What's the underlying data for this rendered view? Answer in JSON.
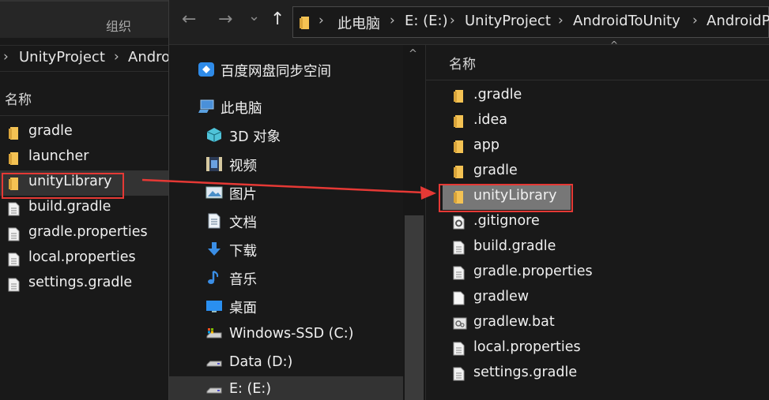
{
  "left_window": {
    "group_label": "组织",
    "breadcrumbs": [
      "UnityProject",
      "Andro"
    ],
    "column_header": "名称",
    "files": [
      {
        "name": "gradle",
        "type": "folder"
      },
      {
        "name": "launcher",
        "type": "folder"
      },
      {
        "name": "unityLibrary",
        "type": "folder",
        "selected": true
      },
      {
        "name": "build.gradle",
        "type": "file"
      },
      {
        "name": "gradle.properties",
        "type": "file"
      },
      {
        "name": "local.properties",
        "type": "file"
      },
      {
        "name": "settings.gradle",
        "type": "file"
      }
    ]
  },
  "right_window": {
    "nav_buttons": {
      "back": "←",
      "forward": "→",
      "recent": "⌄",
      "up": "↑"
    },
    "breadcrumbs": [
      "此电脑",
      "E: (E:)",
      "UnityProject",
      "AndroidToUnity",
      "AndroidP"
    ],
    "nav_tree": [
      {
        "label": "百度网盘同步空间",
        "icon": "baidu-netdisk-icon"
      },
      {
        "label": "此电脑",
        "icon": "this-pc-icon"
      },
      {
        "label": "3D 对象",
        "icon": "3d-objects-icon"
      },
      {
        "label": "视频",
        "icon": "videos-icon"
      },
      {
        "label": "图片",
        "icon": "pictures-icon"
      },
      {
        "label": "文档",
        "icon": "documents-icon"
      },
      {
        "label": "下载",
        "icon": "downloads-icon"
      },
      {
        "label": "音乐",
        "icon": "music-icon"
      },
      {
        "label": "桌面",
        "icon": "desktop-icon"
      },
      {
        "label": "Windows-SSD (C:)",
        "icon": "drive-icon"
      },
      {
        "label": "Data (D:)",
        "icon": "drive-icon"
      },
      {
        "label": "E: (E:)",
        "icon": "drive-icon",
        "selected": true
      }
    ],
    "column_header": "名称",
    "files": [
      {
        "name": ".gradle",
        "type": "folder"
      },
      {
        "name": ".idea",
        "type": "folder"
      },
      {
        "name": "app",
        "type": "folder"
      },
      {
        "name": "gradle",
        "type": "folder"
      },
      {
        "name": "unityLibrary",
        "type": "folder",
        "selected": true
      },
      {
        "name": ".gitignore",
        "type": "config"
      },
      {
        "name": "build.gradle",
        "type": "file"
      },
      {
        "name": "gradle.properties",
        "type": "file"
      },
      {
        "name": "gradlew",
        "type": "blank"
      },
      {
        "name": "gradlew.bat",
        "type": "bat"
      },
      {
        "name": "local.properties",
        "type": "file"
      },
      {
        "name": "settings.gradle",
        "type": "file"
      }
    ]
  },
  "colors": {
    "annotation": "#e53935",
    "folder": "#f4c253",
    "selection": "#777777"
  }
}
